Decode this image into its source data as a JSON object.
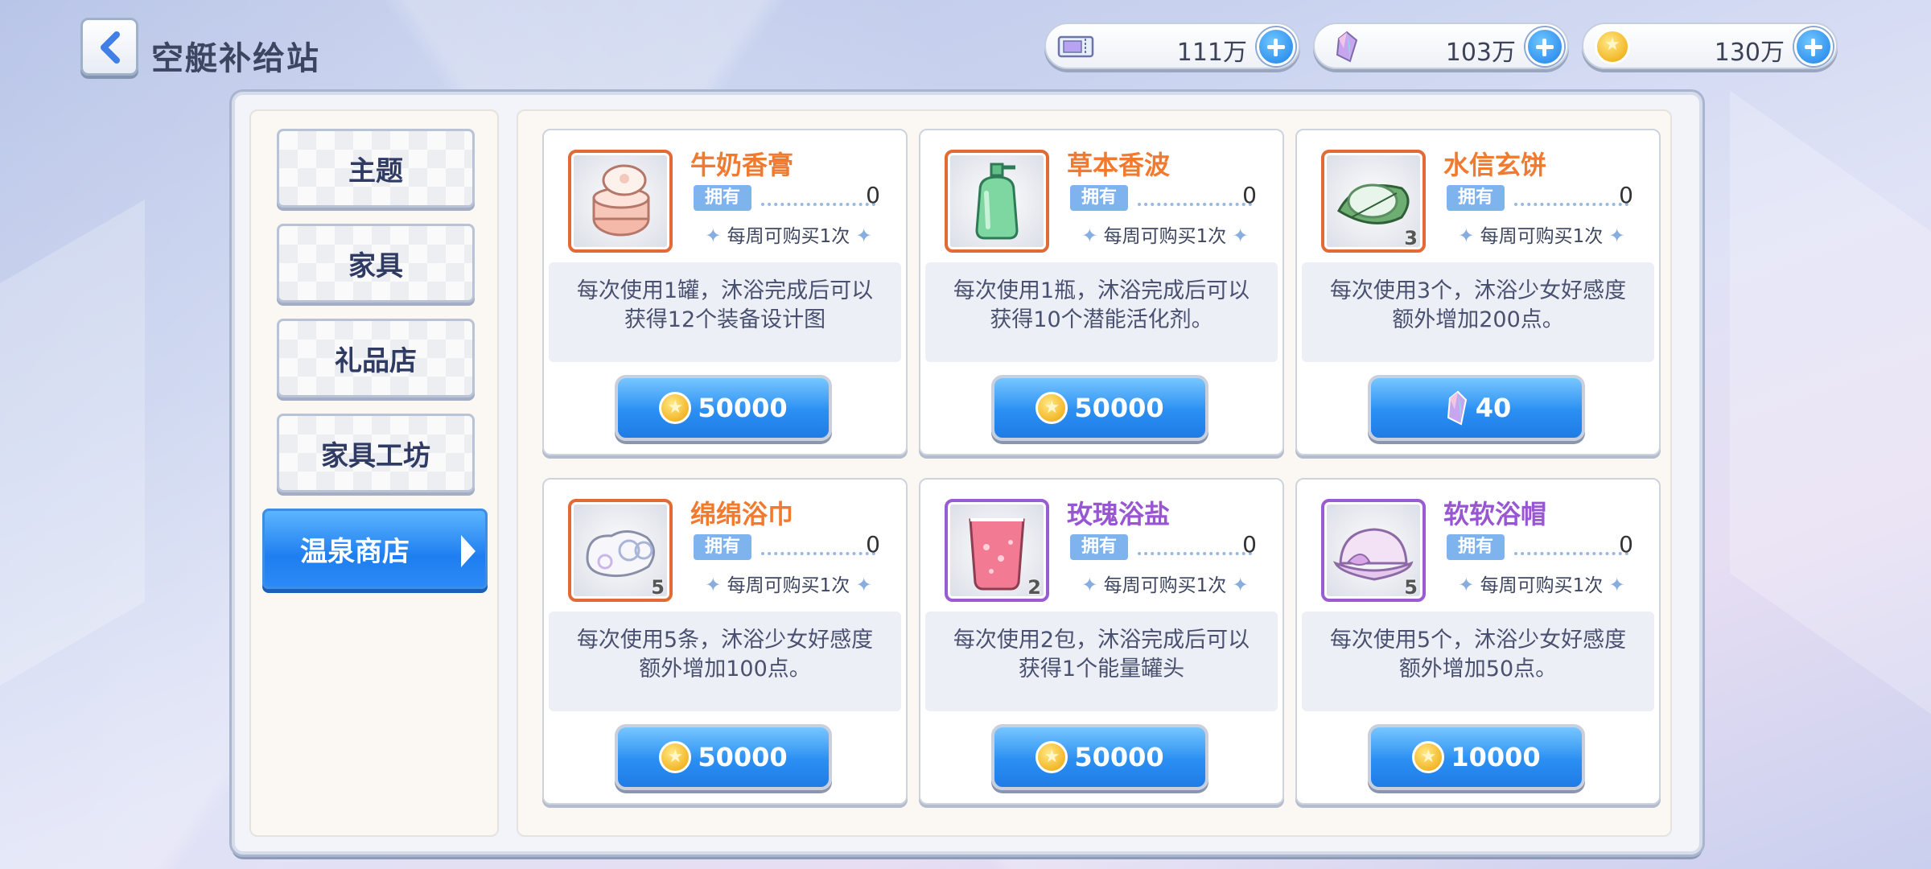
{
  "header": {
    "title": "空艇补给站",
    "currencies": [
      {
        "icon": "ticket-icon",
        "value": "111万"
      },
      {
        "icon": "crystal-icon",
        "value": "103万"
      },
      {
        "icon": "coin-icon",
        "value": "130万"
      }
    ]
  },
  "sidebar": {
    "items": [
      {
        "label": "主题"
      },
      {
        "label": "家具"
      },
      {
        "label": "礼品店"
      },
      {
        "label": "家具工坊"
      },
      {
        "label": "温泉商店",
        "active": true
      }
    ]
  },
  "shop": {
    "owned_label": "拥有",
    "items": [
      {
        "name": "牛奶香膏",
        "owned": "0",
        "limit": "每周可购买1次",
        "qty": "",
        "desc_line1": "每次使用1罐，沐浴完成后可以",
        "desc_line2": "获得12个装备设计图",
        "currency": "coin",
        "price": "50000",
        "frame": "orange",
        "icon": "cream-jar-icon"
      },
      {
        "name": "草本香波",
        "owned": "0",
        "limit": "每周可购买1次",
        "qty": "",
        "desc_line1": "每次使用1瓶，沐浴完成后可以",
        "desc_line2": "获得10个潜能活化剂。",
        "currency": "coin",
        "price": "50000",
        "frame": "orange",
        "icon": "shampoo-bottle-icon"
      },
      {
        "name": "水信玄饼",
        "owned": "0",
        "limit": "每周可购买1次",
        "qty": "3",
        "desc_line1": "每次使用3个，沐浴少女好感度",
        "desc_line2": "额外增加200点。",
        "currency": "crystal",
        "price": "40",
        "frame": "orange",
        "icon": "rice-cake-icon"
      },
      {
        "name": "绵绵浴巾",
        "owned": "0",
        "limit": "每周可购买1次",
        "qty": "5",
        "desc_line1": "每次使用5条，沐浴少女好感度",
        "desc_line2": "额外增加100点。",
        "currency": "coin",
        "price": "50000",
        "frame": "orange",
        "icon": "towel-icon"
      },
      {
        "name": "玫瑰浴盐",
        "owned": "0",
        "limit": "每周可购买1次",
        "qty": "2",
        "desc_line1": "每次使用2包，沐浴完成后可以",
        "desc_line2": "获得1个能量罐头",
        "currency": "coin",
        "price": "50000",
        "frame": "purple",
        "icon": "bath-salt-icon"
      },
      {
        "name": "软软浴帽",
        "owned": "0",
        "limit": "每周可购买1次",
        "qty": "5",
        "desc_line1": "每次使用5个，沐浴少女好感度",
        "desc_line2": "额外增加50点。",
        "currency": "coin",
        "price": "10000",
        "frame": "purple",
        "icon": "bath-cap-icon"
      }
    ]
  },
  "colors": {
    "accent_blue": "#2a8ff2",
    "name_orange": "#f07a2f",
    "name_purple": "#9956d2"
  }
}
